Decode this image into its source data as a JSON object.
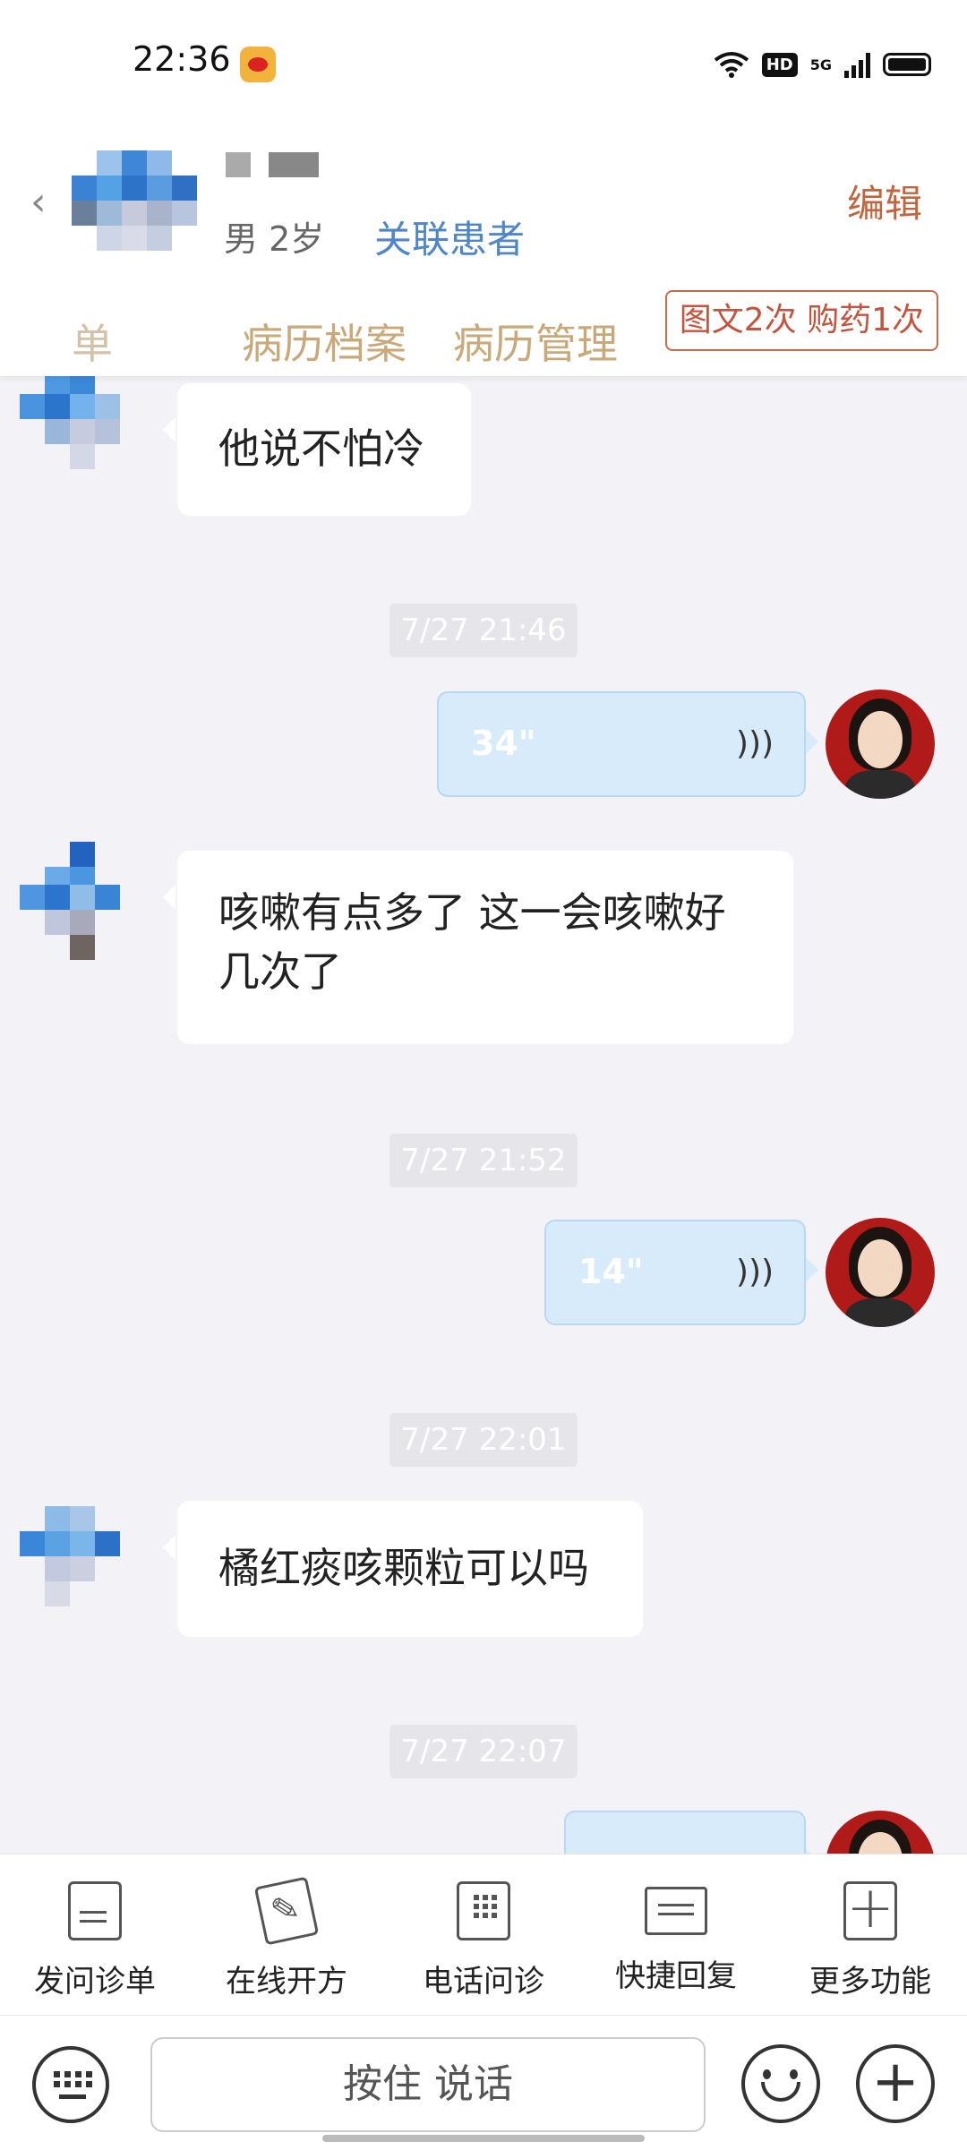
{
  "status_bar": {
    "time": "22:36",
    "network": "5G",
    "hd": "HD"
  },
  "header": {
    "patient_info": "男 2岁",
    "link_patient": "关联患者",
    "edit": "编辑",
    "tabs": [
      "单",
      "病历档案",
      "病历管理"
    ],
    "quota": "图文2次 购药1次"
  },
  "messages": {
    "m1": "他说不怕冷",
    "ts1": "7/27 21:46",
    "voice1": "34\"",
    "m2": "咳嗽有点多了  这一会咳嗽好几次了",
    "ts2": "7/27 21:52",
    "voice2": "14\"",
    "ts3": "7/27 22:01",
    "m3": "橘红痰咳颗粒可以吗",
    "ts4": "7/27 22:07"
  },
  "actions": [
    "发问诊单",
    "在线开方",
    "电话问诊",
    "快捷回复",
    "更多功能"
  ],
  "input": {
    "talk_label": "按住 说话"
  },
  "colors": {
    "accent": "#c0663e",
    "link": "#4e86c8",
    "voice_bubble": "#d8ebfa",
    "tab": "#c9a97a"
  }
}
